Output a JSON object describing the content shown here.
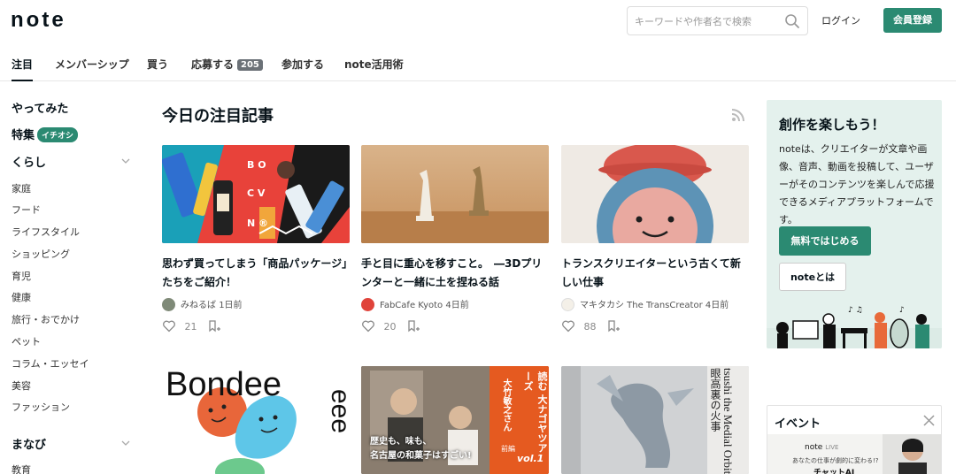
{
  "header": {
    "logo": "note",
    "search_placeholder": "キーワードや作者名で検索",
    "login_label": "ログイン",
    "register_label": "会員登録"
  },
  "tabs": [
    {
      "label": "注目"
    },
    {
      "label": "メンバーシップ"
    },
    {
      "label": "買う"
    },
    {
      "label": "応募する",
      "badge": "205"
    },
    {
      "label": "参加する"
    },
    {
      "label": "note活用術"
    }
  ],
  "sidebar": {
    "main_items": [
      {
        "label": "やってみた"
      },
      {
        "label": "特集",
        "badge": "イチオシ"
      },
      {
        "label": "くらし"
      },
      {
        "label": "まなび"
      }
    ],
    "kurashi_items": [
      "家庭",
      "フード",
      "ライフスタイル",
      "ショッピング",
      "育児",
      "健康",
      "旅行・おでかけ",
      "ペット",
      "コラム・エッセイ",
      "美容",
      "ファッション"
    ],
    "manabi_items": [
      "教育"
    ]
  },
  "main": {
    "section_title": "今日の注目記事",
    "cards": [
      {
        "title": "思わず買ってしまう「商品パッケージ」たちをご紹介！",
        "author": "みねるば",
        "date": "1日前",
        "likes": "21"
      },
      {
        "title": "手と目に重心を移すこと。　―3Dプリンターと一緒に土を捏ねる話",
        "author": "FabCafe Kyoto",
        "date": "4日前",
        "likes": "20"
      },
      {
        "title": "トランスクリエイターという古くて新しい仕事",
        "author": "マキタカシ The TransCreator",
        "date": "4日前",
        "likes": "88"
      }
    ],
    "row2_images": {
      "bondee_text": "Bondee",
      "bondee_side": "eee",
      "nagoya_caption_1": "歴史も、味も、",
      "nagoya_caption_2": "名古屋の和菓子はすごい!",
      "nagoya_vertical": "読む 大ナゴヤツアーズ",
      "nagoya_name": "大竹敏之さん",
      "nagoya_vol": "vol.1",
      "nagoya_tag": "前編",
      "tsushi_vertical": "tsushi the Medial Orbito-I",
      "tsushi_jp": "眼高裏の火事"
    }
  },
  "promo": {
    "title": "創作を楽しもう！",
    "description": "noteは、クリエイターが文章や画像、音声、動画を投稿して、ユーザーがそのコンテンツを楽しんで応援できるメディアプラットフォームです。",
    "primary_button": "無料ではじめる",
    "secondary_button": "noteとは"
  },
  "event": {
    "title": "イベント",
    "banner_logo": "note",
    "banner_logo_sub": "LIVE",
    "banner_sub": "あなたの仕事が劇的に変わる!?",
    "banner_partial": "チャットAI"
  },
  "colors": {
    "accent": "#2b8a72",
    "promo_bg": "#e4f1ed"
  }
}
